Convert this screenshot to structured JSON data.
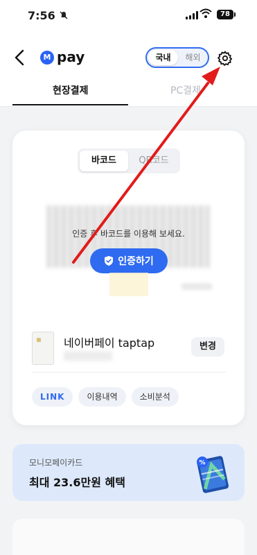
{
  "status_bar": {
    "time": "7:56",
    "battery": "78"
  },
  "header": {
    "back_icon": "chevron-left-icon",
    "logo_text": "M",
    "brand": "pay",
    "region_toggle": {
      "selected": "국내",
      "other": "해외"
    },
    "settings_icon": "gear-icon"
  },
  "tabs": [
    {
      "label": "현장결제",
      "active": true
    },
    {
      "label": "PC결제",
      "active": false
    }
  ],
  "card": {
    "code_toggle": {
      "selected": "바코드",
      "other": "QR코드"
    },
    "auth_message": "인증 후 바코드를 이용해 보세요.",
    "auth_button": "인증하기",
    "payment_method": {
      "name": "네이버페이 taptap"
    },
    "change_button": "변경",
    "chips": [
      "LINK",
      "이용내역",
      "소비분석"
    ]
  },
  "promo": {
    "subtitle": "모니모페이카드",
    "title": "최대 23.6만원 혜택"
  },
  "colors": {
    "accent": "#2f6bf0",
    "annotation_arrow": "#e21b1b",
    "promo_bg": "#dde9fb"
  }
}
